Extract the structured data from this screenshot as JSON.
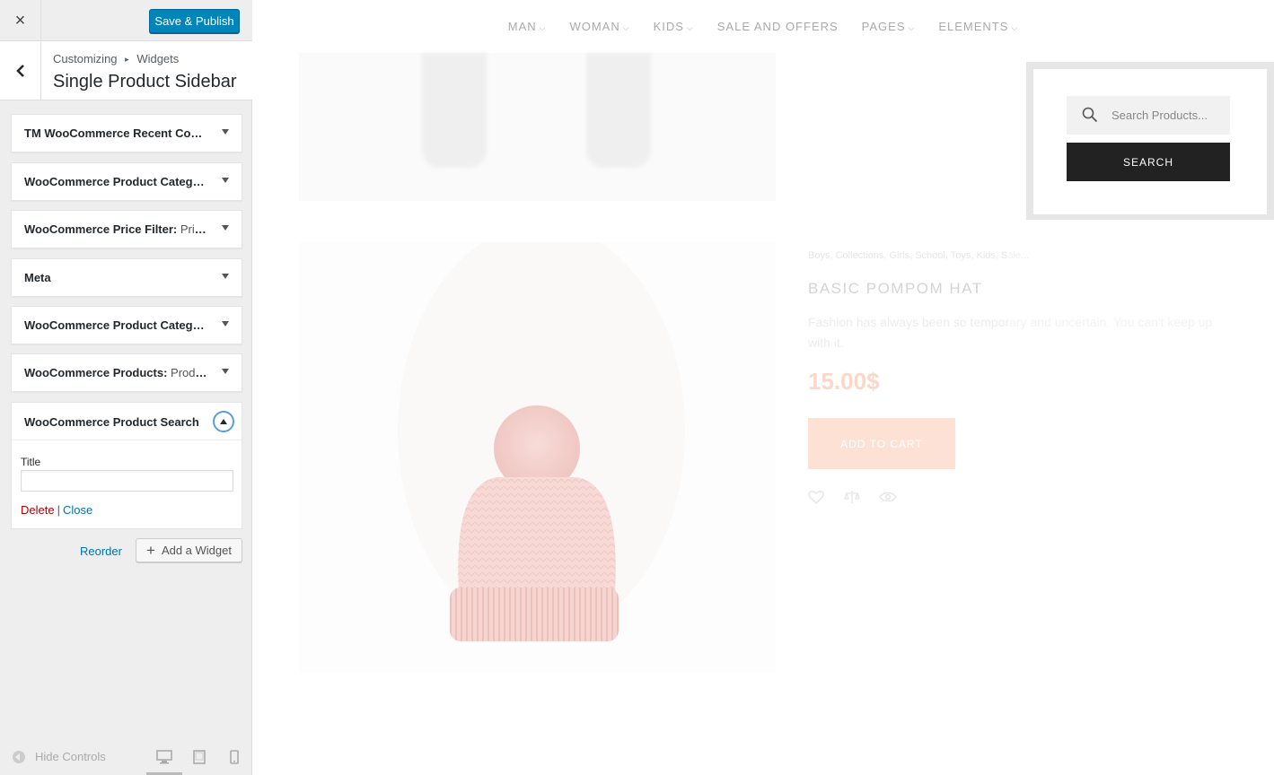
{
  "customizer": {
    "close_label": "×",
    "publish_label": "Save & Publish",
    "breadcrumb": [
      "Customizing",
      "Widgets"
    ],
    "breadcrumb_sep": "▸",
    "section_title": "Single Product Sidebar",
    "widgets": [
      {
        "name": "TM WooCommerce Recent Com...",
        "sub": ""
      },
      {
        "name": "WooCommerce Product Categor...",
        "sub": ""
      },
      {
        "name": "WooCommerce Price Filter:",
        "sub": " Pric..."
      },
      {
        "name": "Meta",
        "sub": ""
      },
      {
        "name": "WooCommerce Product Categor...",
        "sub": ""
      },
      {
        "name": "WooCommerce Products:",
        "sub": " Produ..."
      }
    ],
    "open_widget": {
      "name": "WooCommerce Product Search",
      "field_label": "Title",
      "field_value": "",
      "delete_label": "Delete",
      "separator": "|",
      "close_label": "Close"
    },
    "reorder_label": "Reorder",
    "add_widget_label": "Add a Widget",
    "hide_controls_label": "Hide Controls",
    "accent_color": "#0085ba"
  },
  "preview": {
    "nav": [
      "MAN",
      "WOMAN",
      "KIDS",
      "SALE AND OFFERS",
      "PAGES",
      "ELEMENTS"
    ],
    "nav_dropdowns": [
      true,
      true,
      true,
      false,
      true,
      true
    ],
    "search_placeholder": "Search Products...",
    "search_button": "SEARCH",
    "categories": "Boys, Collections, Girls, School, Toys, Kids, Sale...",
    "product_title": "BASIC POMPOM HAT",
    "product_desc": "Fashion has always been so temporary and uncertain. You can't keep up with it.",
    "price": "15.00$",
    "add_to_cart": "ADD TO CART",
    "icons": [
      "heart-icon",
      "compare-icon",
      "eye-icon"
    ]
  }
}
